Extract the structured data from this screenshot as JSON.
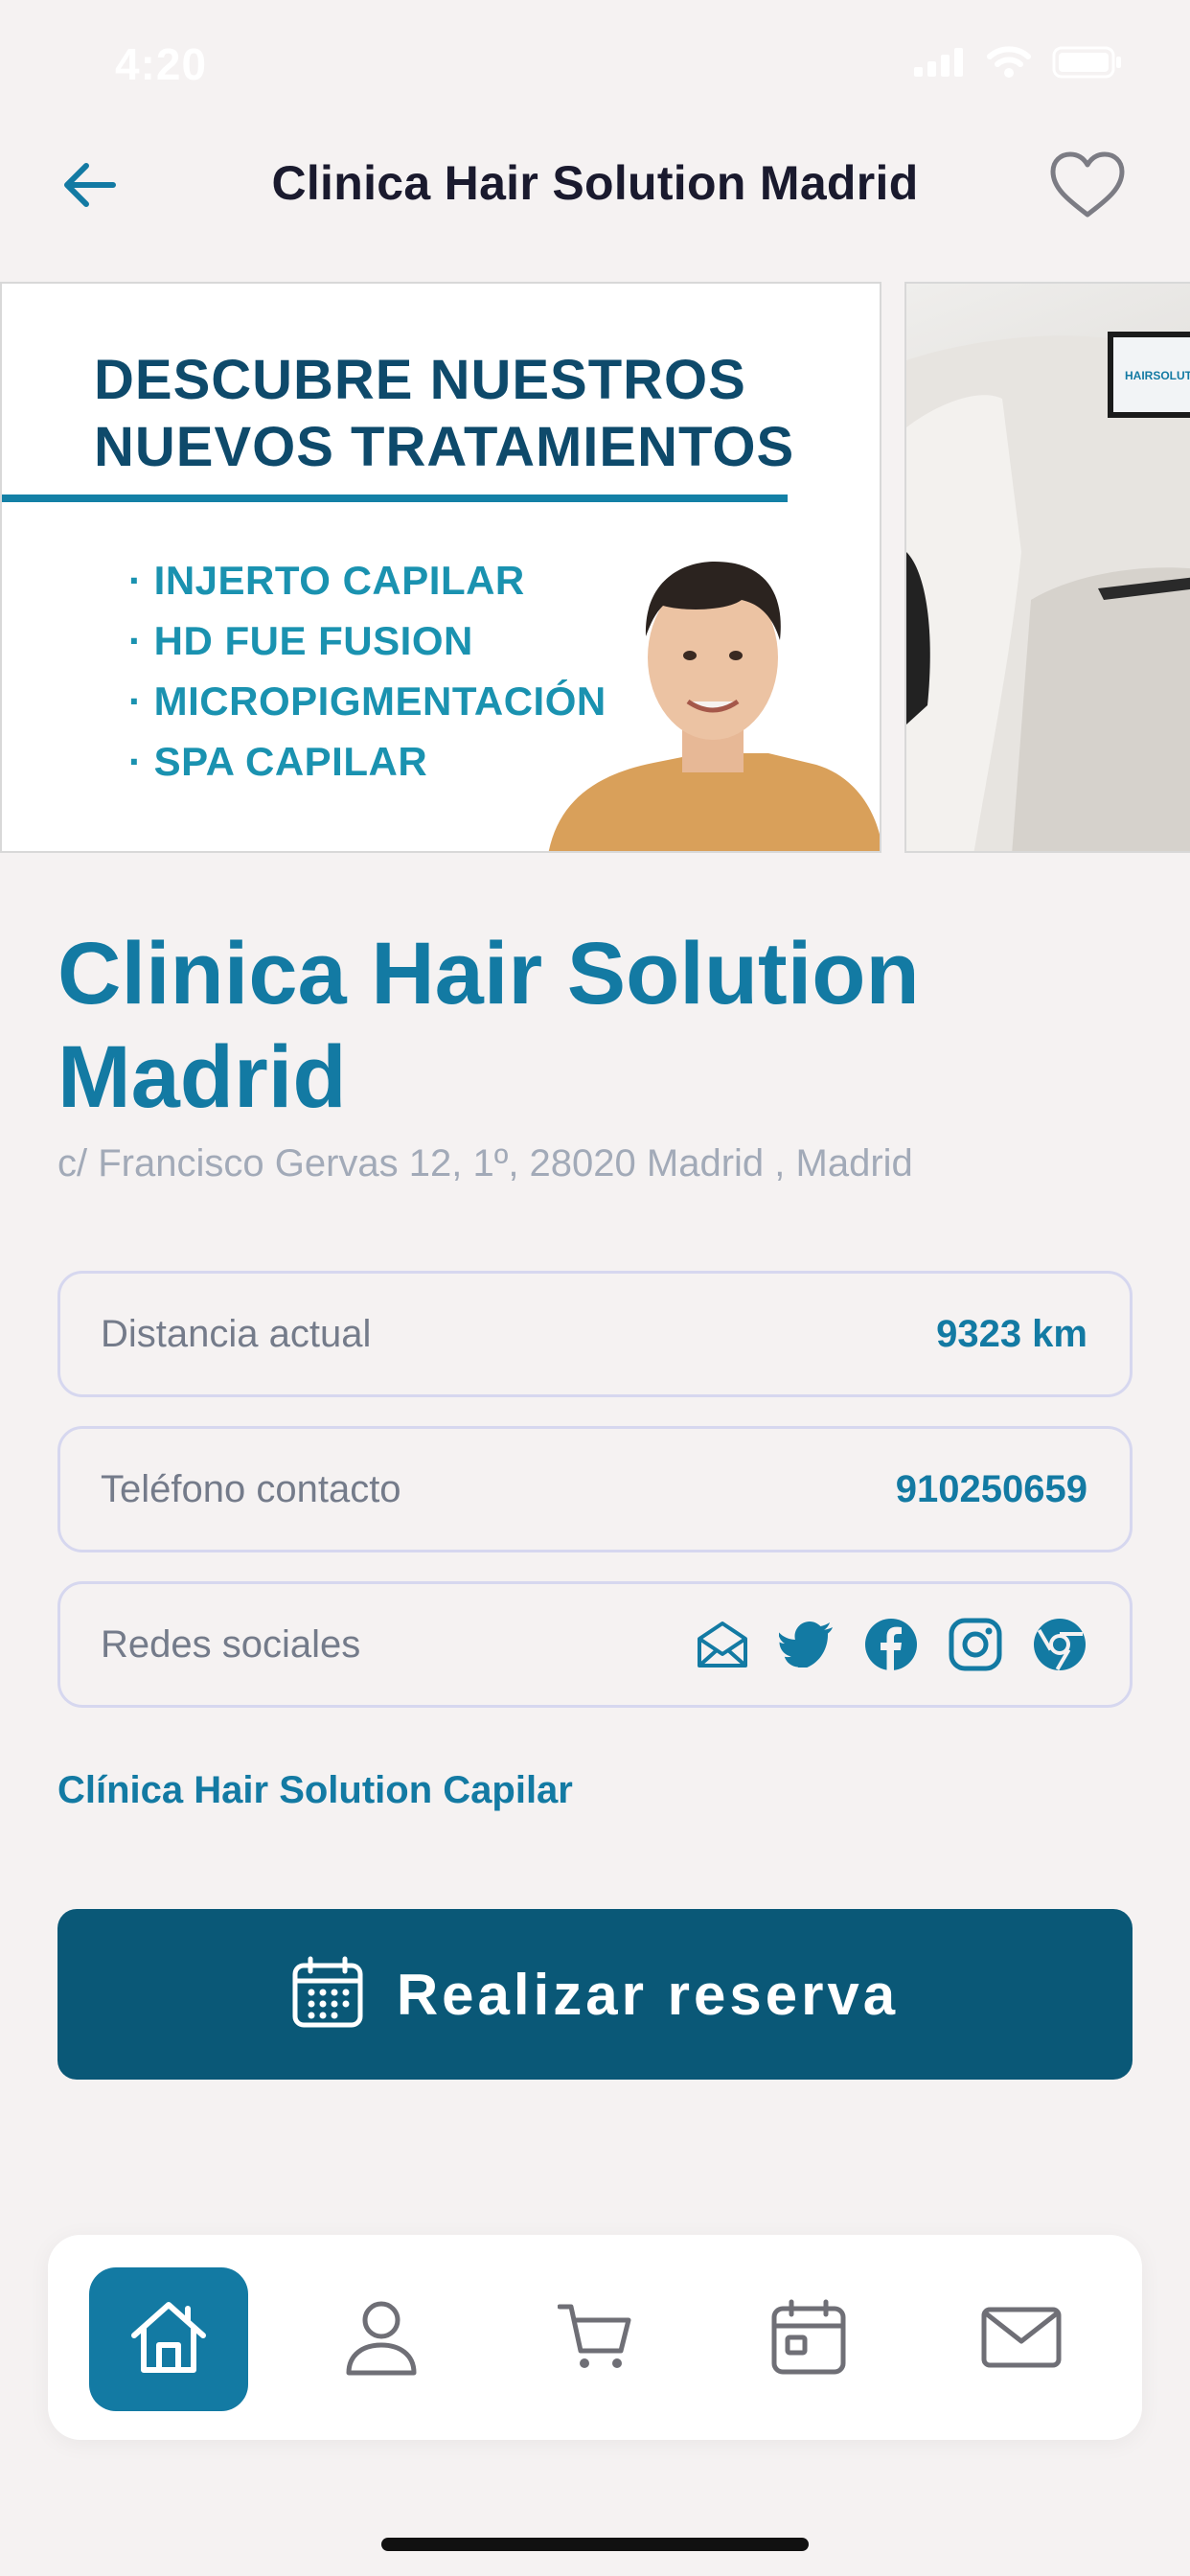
{
  "status_bar": {
    "time": "4:20"
  },
  "header": {
    "title": "Clinica Hair Solution Madrid"
  },
  "carousel": {
    "slides": [
      {
        "title_line_1": "DESCUBRE NUESTROS",
        "title_line_2": "NUEVOS TRATAMIENTOS",
        "items": [
          "INJERTO CAPILAR",
          "HD FUE FUSION",
          "MICROPIGMENTACIÓN",
          "SPA CAPILAR"
        ]
      },
      {
        "screen_text": "HAIRSOLUTION"
      }
    ]
  },
  "clinic": {
    "name": "Clinica Hair Solution Madrid",
    "address": "c/ Francisco Gervas 12, 1º, 28020 Madrid , Madrid"
  },
  "info_rows": {
    "distance": {
      "label": "Distancia actual",
      "value": "9323 km"
    },
    "phone": {
      "label": "Teléfono contacto",
      "value": "910250659"
    },
    "social": {
      "label": "Redes sociales",
      "icons": [
        "email-icon",
        "twitter-icon",
        "facebook-icon",
        "instagram-icon",
        "chrome-icon"
      ]
    }
  },
  "clinic_link": "Clínica Hair Solution Capilar",
  "cta": {
    "label": "Realizar reserva",
    "icon": "calendar-icon"
  },
  "bottom_nav": {
    "items": [
      "home-icon",
      "profile-icon",
      "cart-icon",
      "calendar-icon",
      "mail-icon"
    ],
    "active": "home-icon"
  },
  "colors": {
    "accent": "#137aa3",
    "button": "#0a5877",
    "background": "#f5f2f2",
    "muted_text": "#a2aab8",
    "border": "#d6d7ef"
  }
}
